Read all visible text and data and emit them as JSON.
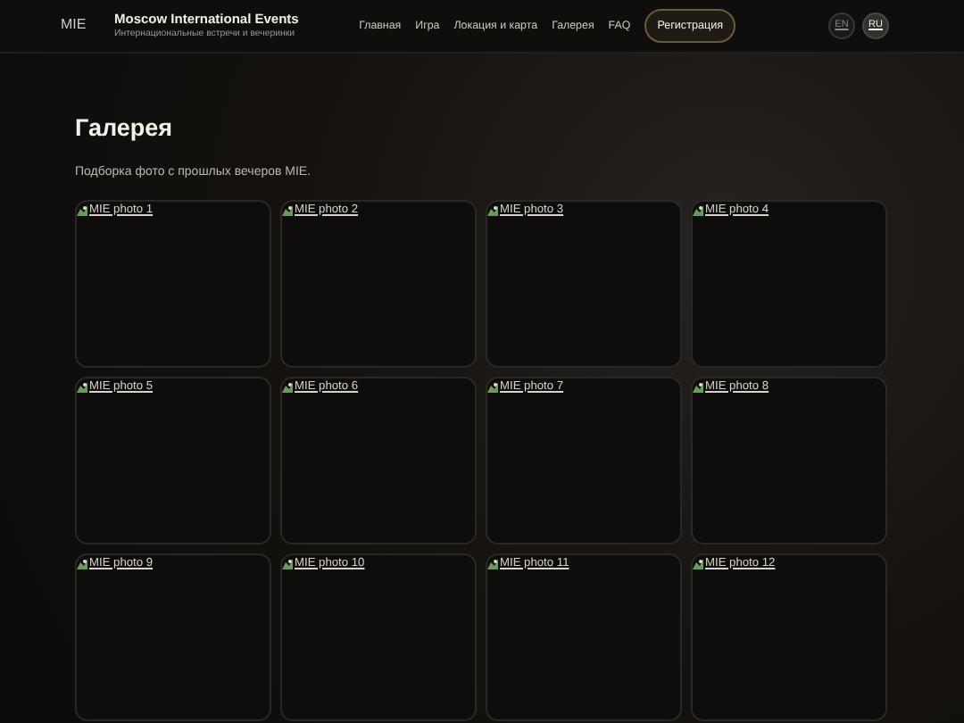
{
  "header": {
    "logo_alt": "MIE",
    "title": "Moscow International Events",
    "subtitle": "Интернациональные встречи и вечеринки",
    "nav": [
      {
        "label": "Главная"
      },
      {
        "label": "Игра"
      },
      {
        "label": "Локация и карта"
      },
      {
        "label": "Галерея"
      },
      {
        "label": "FAQ"
      }
    ],
    "cta": "Регистрация",
    "languages": [
      {
        "label": "EN",
        "selected": false
      },
      {
        "label": "RU",
        "selected": true
      }
    ]
  },
  "page": {
    "heading": "Галерея",
    "description": "Подборка фото с прошлых вечеров MIE."
  },
  "gallery": [
    {
      "alt": "MIE photo 1"
    },
    {
      "alt": "MIE photo 2"
    },
    {
      "alt": "MIE photo 3"
    },
    {
      "alt": "MIE photo 4"
    },
    {
      "alt": "MIE photo 5"
    },
    {
      "alt": "MIE photo 6"
    },
    {
      "alt": "MIE photo 7"
    },
    {
      "alt": "MIE photo 8"
    },
    {
      "alt": "MIE photo 9"
    },
    {
      "alt": "MIE photo 10"
    },
    {
      "alt": "MIE photo 11"
    },
    {
      "alt": "MIE photo 12"
    }
  ]
}
